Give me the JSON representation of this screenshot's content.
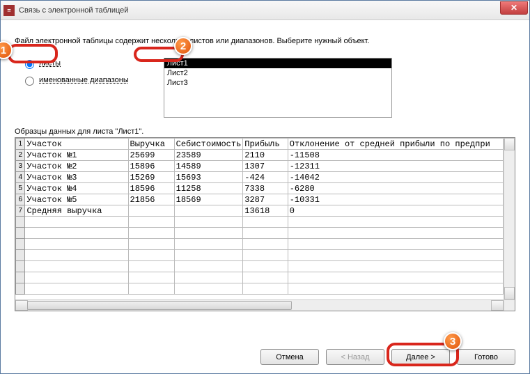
{
  "window": {
    "title": "Связь с электронной таблицей"
  },
  "instruction": "Файл электронной таблицы содержит несколько листов или диапазонов.  Выберите нужный объект.",
  "radios": {
    "sheets": "листы",
    "ranges": "именованные диапазоны"
  },
  "listbox": {
    "items": [
      "Лист1",
      "Лист2",
      "Лист3"
    ],
    "selected": 0
  },
  "sample_label": "Образцы данных для листа \"Лист1\".",
  "table": {
    "rows": [
      [
        "Участок",
        "Выручка",
        "Себистоимость",
        "Прибыль",
        "Отклонение от средней прибыли по предпри"
      ],
      [
        "Участок №1",
        "25699",
        "23589",
        "2110",
        "-11508"
      ],
      [
        "Участок №2",
        "15896",
        "14589",
        "1307",
        "-12311"
      ],
      [
        "Участок №3",
        "15269",
        "15693",
        "-424",
        "-14042"
      ],
      [
        "Участок №4",
        "18596",
        "11258",
        "7338",
        "-6280"
      ],
      [
        "Участок №5",
        "21856",
        "18569",
        "3287",
        "-10331"
      ],
      [
        "Средняя выручка",
        "",
        "",
        "13618",
        "0"
      ]
    ],
    "blank_rows": 7
  },
  "buttons": {
    "cancel": "Отмена",
    "back": "< Назад",
    "next": "Далее >",
    "finish": "Готово"
  },
  "badges": [
    "1",
    "2",
    "3"
  ]
}
